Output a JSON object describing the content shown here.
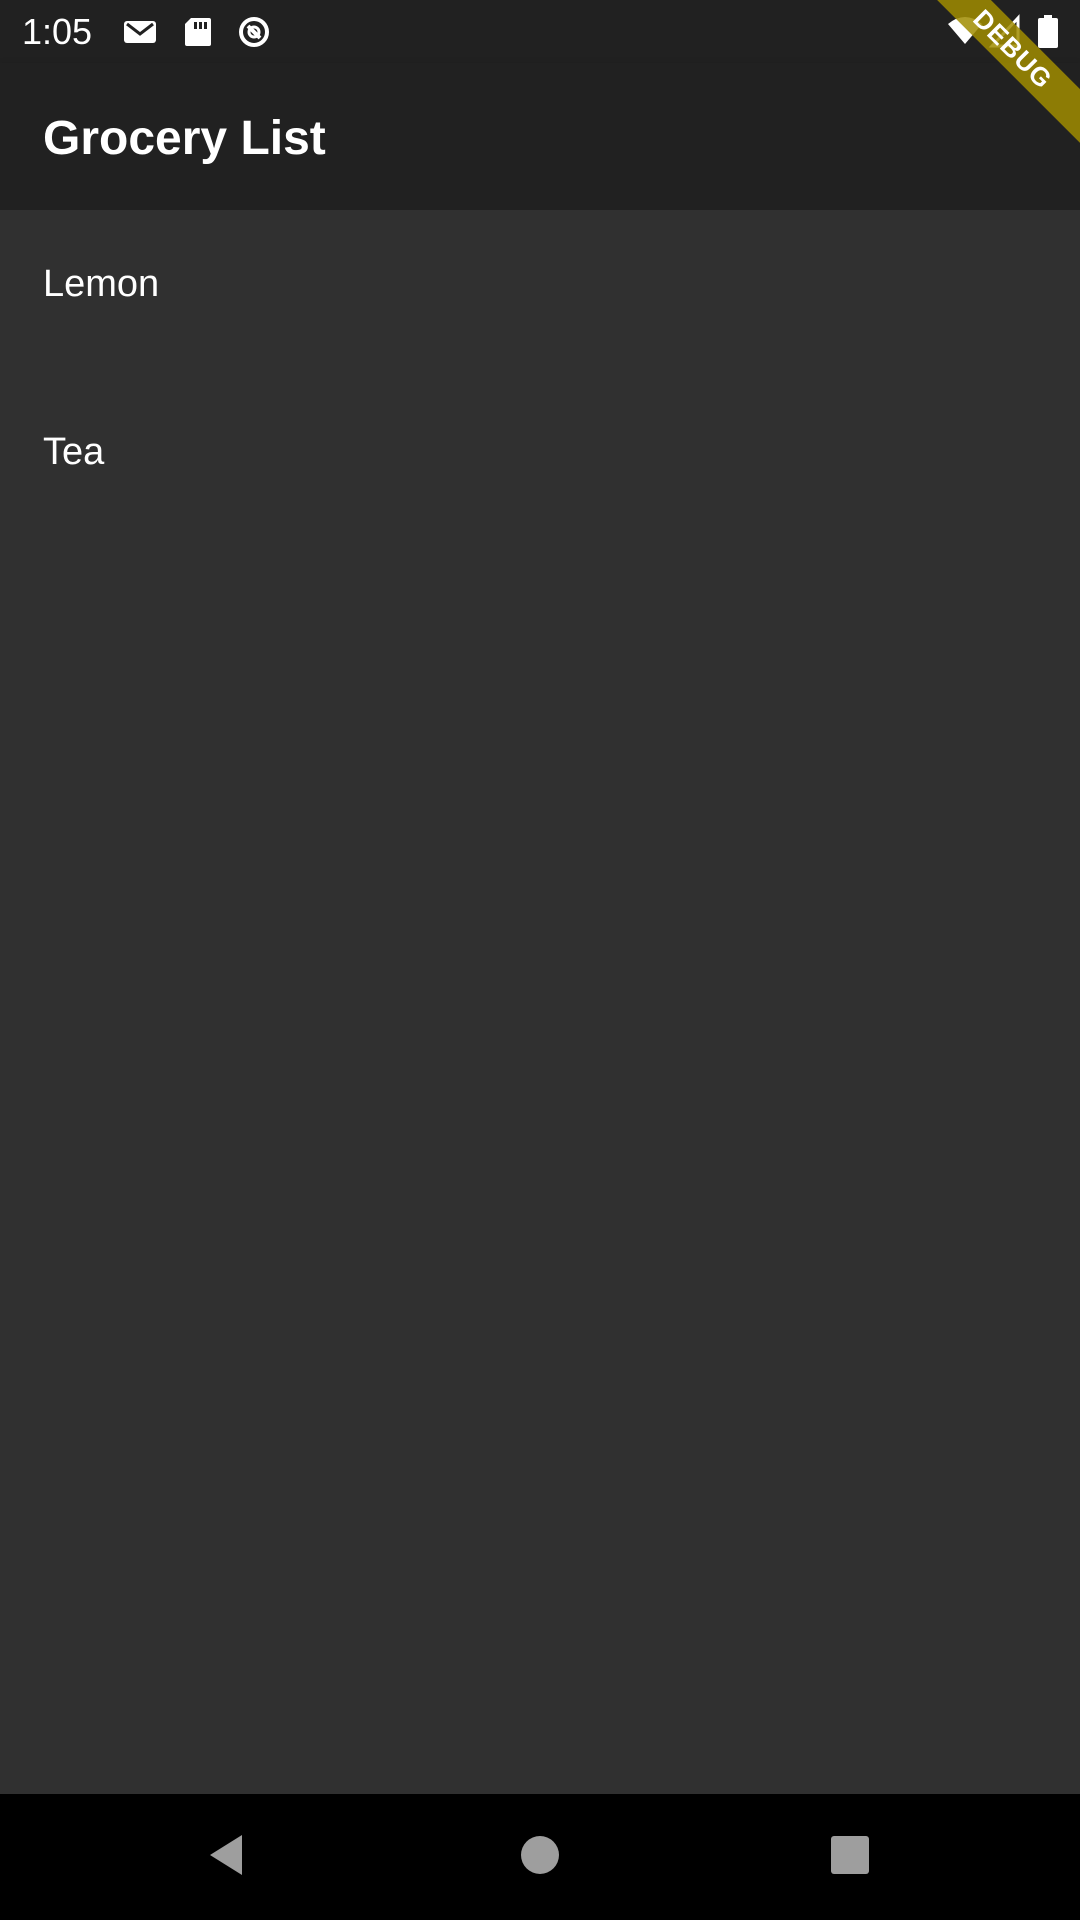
{
  "status_bar": {
    "time": "1:05",
    "icons_left": [
      "gmail-icon",
      "sd-card-icon",
      "sync-icon"
    ],
    "icons_right": [
      "wifi-icon",
      "signal-icon",
      "battery-icon"
    ]
  },
  "app_bar": {
    "title": "Grocery List"
  },
  "list": {
    "items": [
      {
        "label": "Lemon"
      },
      {
        "label": "Tea"
      }
    ]
  },
  "debug_banner": {
    "label": "DEBUG"
  },
  "nav_bar": {
    "buttons": [
      "back-icon",
      "home-icon",
      "recents-icon"
    ]
  },
  "colors": {
    "background": "#303030",
    "app_bar": "#212121",
    "text": "#ffffff",
    "nav_bar": "#000000",
    "debug_ribbon": "#a08c00"
  }
}
